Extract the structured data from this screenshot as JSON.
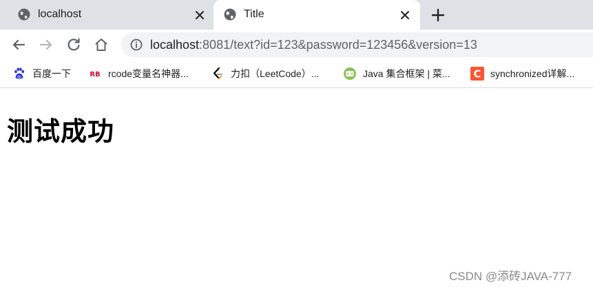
{
  "colors": {
    "tabstrip_bg": "#dee1e6",
    "active_tab_bg": "#ffffff",
    "omnibox_bg": "#f1f3f4",
    "text": "#202124",
    "muted": "#5f6368",
    "baidu_blue": "#2932e1",
    "rcode_red": "#c8102e",
    "leetcode_orange": "#f89f1b",
    "runoob_green": "#8cc152",
    "csdn_red": "#fc5531"
  },
  "tabs": [
    {
      "title": "localhost",
      "icon": "globe-icon",
      "active": false
    },
    {
      "title": "Title",
      "icon": "globe-icon",
      "active": true
    }
  ],
  "toolbar": {
    "url_host": "localhost",
    "url_rest": ":8081/text?id=123&password=123456&version=13"
  },
  "bookmarks": [
    {
      "label": "百度一下",
      "icon": "baidu-paw-icon"
    },
    {
      "label": "rcode变量名神器...",
      "icon": "rb-logo-icon"
    },
    {
      "label": "力扣（LeetCode）...",
      "icon": "leetcode-icon"
    },
    {
      "label": "Java 集合框架 | 菜...",
      "icon": "runoob-icon"
    },
    {
      "label": "synchronized详解...",
      "icon": "csdn-icon"
    }
  ],
  "page": {
    "heading": "测试成功"
  },
  "watermark": "CSDN @添砖JAVA-777"
}
